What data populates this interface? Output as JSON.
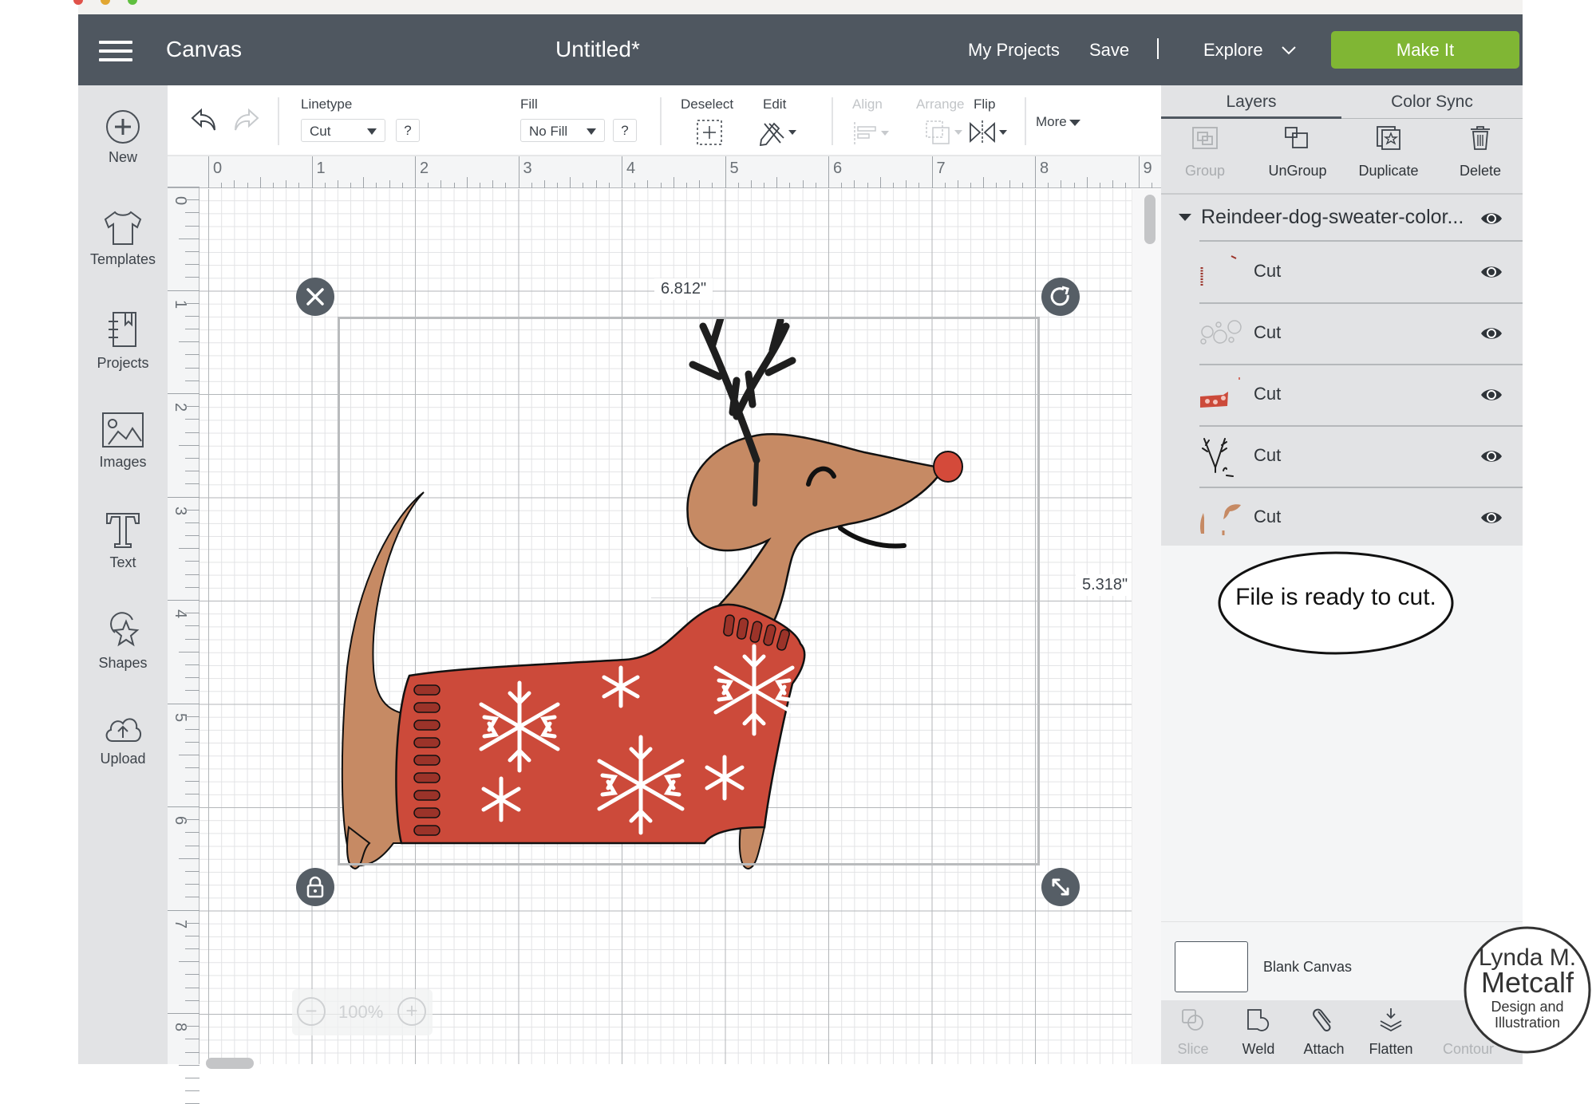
{
  "header": {
    "app_name": "Canvas",
    "doc_title": "Untitled*",
    "nav": {
      "my_projects": "My Projects",
      "save": "Save",
      "explore": "Explore"
    },
    "make_it": "Make It",
    "accent_color": "#80b634"
  },
  "sidebar": {
    "items": [
      {
        "label": "New",
        "icon": "plus-circle-icon"
      },
      {
        "label": "Templates",
        "icon": "tshirt-icon"
      },
      {
        "label": "Projects",
        "icon": "notebook-icon"
      },
      {
        "label": "Images",
        "icon": "image-icon"
      },
      {
        "label": "Text",
        "icon": "text-icon"
      },
      {
        "label": "Shapes",
        "icon": "shapes-icon"
      },
      {
        "label": "Upload",
        "icon": "upload-cloud-icon"
      }
    ]
  },
  "toolbar": {
    "linetype_label": "Linetype",
    "linetype_value": "Cut",
    "fill_label": "Fill",
    "fill_value": "No Fill",
    "help": "?",
    "deselect": "Deselect",
    "edit": "Edit",
    "align": "Align",
    "arrange": "Arrange",
    "flip": "Flip",
    "more": "More"
  },
  "rulers": {
    "horizontal": [
      "0",
      "1",
      "2",
      "3",
      "4",
      "5",
      "6",
      "7",
      "8",
      "9"
    ],
    "vertical": [
      "0",
      "1",
      "2",
      "3",
      "4",
      "5",
      "6",
      "7",
      "8"
    ]
  },
  "canvas": {
    "selection_width": "6.812\"",
    "selection_height": "5.318\"",
    "zoom_level": "100%",
    "zoom_out": "−",
    "zoom_in": "+"
  },
  "right_panel": {
    "tabs": [
      "Layers",
      "Color Sync"
    ],
    "actions": [
      {
        "label": "Group",
        "enabled": false
      },
      {
        "label": "UnGroup",
        "enabled": true
      },
      {
        "label": "Duplicate",
        "enabled": true
      },
      {
        "label": "Delete",
        "enabled": true
      }
    ],
    "group_name": "Reindeer-dog-sweater-color...",
    "layers": [
      {
        "name": "Cut",
        "thumb": "sweater-ribbing"
      },
      {
        "name": "Cut",
        "thumb": "snowflakes"
      },
      {
        "name": "Cut",
        "thumb": "sweater"
      },
      {
        "name": "Cut",
        "thumb": "antlers-face"
      },
      {
        "name": "Cut",
        "thumb": "dog-body"
      }
    ],
    "blank_canvas": "Blank Canvas",
    "bottom_actions": [
      {
        "label": "Slice",
        "enabled": false
      },
      {
        "label": "Weld",
        "enabled": true
      },
      {
        "label": "Attach",
        "enabled": true
      },
      {
        "label": "Flatten",
        "enabled": true
      },
      {
        "label": "Contour",
        "enabled": false
      }
    ]
  },
  "callout": {
    "text": "File is ready to cut."
  },
  "watermark": {
    "line1": "Lynda M.",
    "line2": "Metcalf",
    "line3": "Design and",
    "line4": "Illustration"
  },
  "colors": {
    "header_bg": "#4f5760",
    "sweater": "#cc4a3a",
    "sweater_cuff": "#9b3329",
    "dog": "#c68a64",
    "nose": "#d44a3a",
    "antlers": "#1e1e1e"
  }
}
